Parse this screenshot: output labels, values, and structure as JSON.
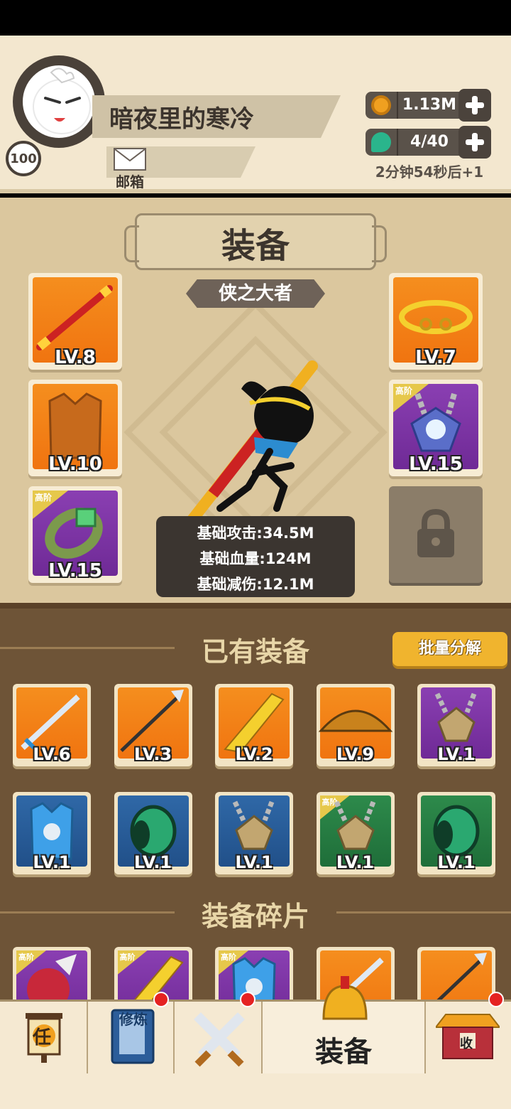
{
  "player": {
    "name": "暗夜里的寒冷",
    "level": "100",
    "mail_label": "邮箱"
  },
  "resources": {
    "coins": "1.13M",
    "energy": "4/40",
    "timer": "2分钟54秒后+1"
  },
  "equip": {
    "title": "装备",
    "rank": "侠之大者",
    "slots": [
      {
        "icon": "staff",
        "level": "LV.8",
        "rarity": "gold"
      },
      {
        "icon": "armor-vest",
        "level": "LV.10",
        "rarity": "gold"
      },
      {
        "icon": "bracelet",
        "level": "LV.15",
        "rarity": "purple",
        "tag": "高阶"
      },
      {
        "icon": "headband",
        "level": "LV.7",
        "rarity": "gold"
      },
      {
        "icon": "necklace",
        "level": "LV.15",
        "rarity": "purple",
        "tag": "高阶"
      },
      {
        "icon": "lock",
        "level": "",
        "rarity": "locked"
      }
    ],
    "stats": [
      "基础攻击:34.5M",
      "基础血量:124M",
      "基础减伤:12.1M"
    ]
  },
  "inventory": {
    "title": "已有装备",
    "bulk_button": "批量分解",
    "items": [
      {
        "icon": "sword",
        "level": "LV.6",
        "rarity": "gold"
      },
      {
        "icon": "spear",
        "level": "LV.3",
        "rarity": "gold"
      },
      {
        "icon": "blade",
        "level": "LV.2",
        "rarity": "gold"
      },
      {
        "icon": "straw-hat",
        "level": "LV.9",
        "rarity": "gold"
      },
      {
        "icon": "necklace",
        "level": "LV.1",
        "rarity": "purple"
      },
      {
        "icon": "armor-vest",
        "level": "LV.1",
        "rarity": "blue"
      },
      {
        "icon": "bracer",
        "level": "LV.1",
        "rarity": "blue"
      },
      {
        "icon": "necklace",
        "level": "LV.1",
        "rarity": "blue"
      },
      {
        "icon": "necklace",
        "level": "LV.1",
        "rarity": "green",
        "tag": "高阶"
      },
      {
        "icon": "bracer",
        "level": "LV.1",
        "rarity": "green"
      }
    ]
  },
  "fragments": {
    "title": "装备碎片",
    "items": [
      {
        "icon": "claw",
        "rarity": "purple",
        "tag": "高阶"
      },
      {
        "icon": "blade",
        "rarity": "purple",
        "tag": "高阶"
      },
      {
        "icon": "armor-vest",
        "rarity": "purple",
        "tag": "高阶"
      },
      {
        "icon": "sword",
        "rarity": "gold"
      },
      {
        "icon": "spear",
        "rarity": "gold"
      }
    ]
  },
  "nav": {
    "tabs": [
      {
        "icon": "task-scroll-icon",
        "label": "任"
      },
      {
        "icon": "cultivate-book-icon",
        "label": "修炼"
      },
      {
        "icon": "battle-swords-icon",
        "label": ""
      },
      {
        "icon": "helmet-icon",
        "label": "装备"
      },
      {
        "icon": "pavilion-icon",
        "label": "收"
      }
    ]
  },
  "colors": {
    "gold": "#f07410",
    "purple": "#7a2fa0",
    "blue": "#215089",
    "green": "#1f6e39",
    "accent": "#f0b42e"
  }
}
